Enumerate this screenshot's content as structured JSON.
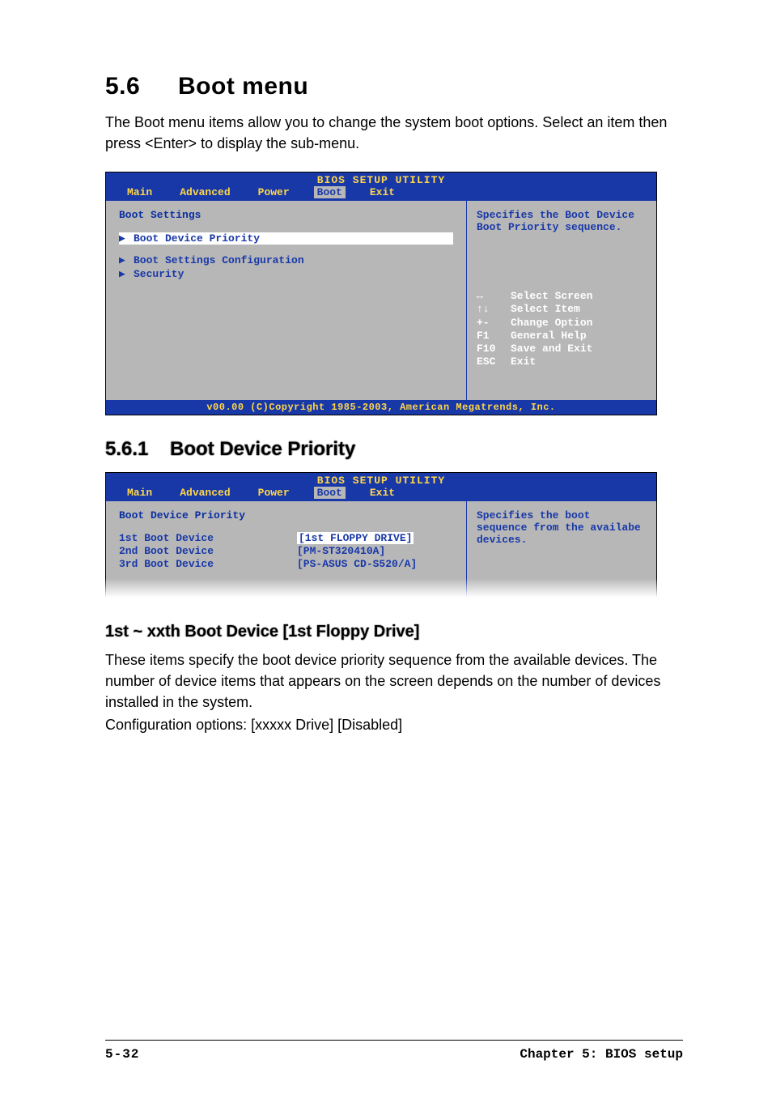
{
  "headings": {
    "h1_num": "5.6",
    "h1_title": "Boot menu",
    "intro": "The Boot menu items allow you to change the system boot options. Select an item then press <Enter> to display the sub-menu.",
    "h2_num": "5.6.1",
    "h2_title": "Boot Device Priority",
    "h3": "1st ~ xxth Boot Device [1st Floppy Drive]",
    "body2_l1": "These items specify the boot device priority sequence from the available devices. The number of device items that appears on the screen depends on the number of devices installed in the system.",
    "body2_l2": "Configuration options: [xxxxx Drive] [Disabled]"
  },
  "bios_common": {
    "title": "BIOS SETUP UTILITY",
    "tabs": [
      "Main",
      "Advanced",
      "Power",
      "Boot",
      "Exit"
    ],
    "active_tab_index": 3,
    "footer": "v00.00 (C)Copyright 1985-2003, American Megatrends, Inc."
  },
  "bios1": {
    "pane_title": "Boot Settings",
    "items": [
      "Boot Device Priority",
      "Boot Settings Configuration",
      "Security"
    ],
    "selected_index": 0,
    "help_text": "Specifies the Boot Device Boot Priority sequence.",
    "keys": [
      {
        "k": "↔",
        "d": "Select Screen"
      },
      {
        "k": "↑↓",
        "d": "Select Item"
      },
      {
        "k": "+-",
        "d": "Change Option"
      },
      {
        "k": "F1",
        "d": "General Help"
      },
      {
        "k": "F10",
        "d": "Save and Exit"
      },
      {
        "k": "ESC",
        "d": "Exit"
      }
    ]
  },
  "bios2": {
    "pane_title": "Boot Device Priority",
    "rows": [
      {
        "k": "1st Boot Device",
        "v": "[1st FLOPPY DRIVE]"
      },
      {
        "k": "2nd Boot Device",
        "v": "[PM-ST320410A]"
      },
      {
        "k": "3rd Boot Device",
        "v": "[PS-ASUS CD-S520/A]"
      }
    ],
    "selected_index": 0,
    "help_text": "Specifies the boot sequence from the availabe devices."
  },
  "footer": {
    "page": "5-32",
    "chapter": "Chapter 5: BIOS setup"
  }
}
